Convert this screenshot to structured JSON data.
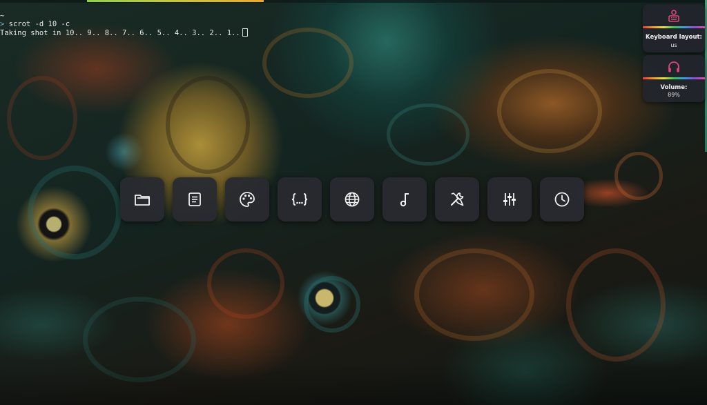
{
  "terminal": {
    "line0": "~",
    "line1_prompt": ">",
    "line1_command": " scrot -d 10 -c",
    "line2": "Taking shot in 10.. 9.. 8.. 7.. 6.. 5.. 4.. 3.. 2.. 1.."
  },
  "widgets": {
    "keyboard": {
      "icon": "keyboard-person-icon",
      "title": "Keyboard layout:",
      "value": "us"
    },
    "volume": {
      "icon": "headphones-icon",
      "title": "Volume:",
      "value": "89%"
    }
  },
  "launcher": {
    "items": [
      {
        "name": "files",
        "icon": "folder-icon"
      },
      {
        "name": "text-editor",
        "icon": "document-icon"
      },
      {
        "name": "graphics",
        "icon": "palette-icon"
      },
      {
        "name": "code-editor",
        "icon": "code-braces-icon"
      },
      {
        "name": "web-browser",
        "icon": "globe-icon"
      },
      {
        "name": "music",
        "icon": "music-note-icon"
      },
      {
        "name": "tools",
        "icon": "wrench-screwdriver-icon"
      },
      {
        "name": "settings",
        "icon": "sliders-icon"
      },
      {
        "name": "clock",
        "icon": "clock-icon"
      }
    ]
  },
  "colors": {
    "workspace_indicator": "#c9c640",
    "widget_icon": "#e0457b",
    "widget_background": "#22262c",
    "launcher_button_background": "#282a30",
    "launcher_icon": "#f0f0f0"
  }
}
